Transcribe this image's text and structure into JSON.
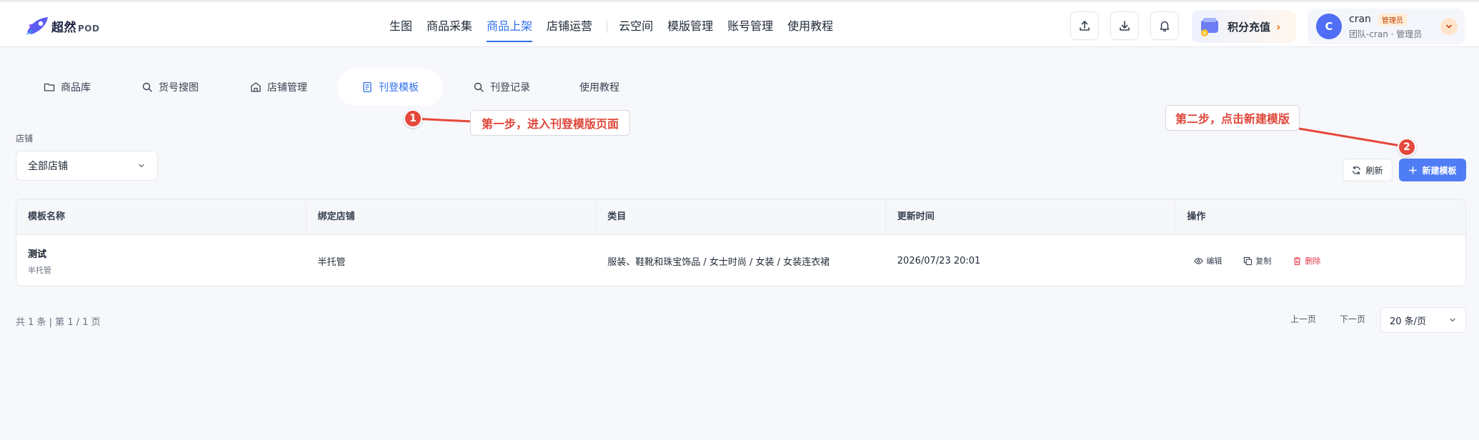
{
  "brand": {
    "logo_text": "超然",
    "logo_suffix": "POD",
    "accent_color": "#2f6fed"
  },
  "topnav": {
    "items": [
      "生图",
      "商品采集",
      "商品上架",
      "店铺运营",
      "云空间",
      "模版管理",
      "账号管理",
      "使用教程"
    ],
    "active": "商品上架"
  },
  "header_icons": [
    "upload-icon",
    "download-icon",
    "bell-icon"
  ],
  "recharge": {
    "label": "积分充值"
  },
  "user": {
    "avatar_letter": "C",
    "name": "cran",
    "role_badge": "管理员",
    "subtitle": "团队-cran · 管理员"
  },
  "tabs": {
    "items": [
      {
        "label": "商品库",
        "icon": "folder-icon"
      },
      {
        "label": "货号搜图",
        "icon": "search-icon"
      },
      {
        "label": "店铺管理",
        "icon": "store-icon"
      },
      {
        "label": "刊登模板",
        "icon": "template-icon"
      },
      {
        "label": "刊登记录",
        "icon": "search-icon"
      },
      {
        "label": "使用教程",
        "icon": ""
      }
    ],
    "active": "刊登模板"
  },
  "filters": {
    "shop_label": "店铺",
    "shop_value": "全部店铺"
  },
  "toolbar": {
    "refresh_label": "刷新",
    "new_label": "新建模板"
  },
  "table": {
    "columns": [
      "模板名称",
      "绑定店铺",
      "类目",
      "更新时间",
      "操作"
    ],
    "rows": [
      {
        "name": "测试",
        "name_sub": "半托管",
        "shop": "半托管",
        "category": "服装、鞋靴和珠宝饰品 / 女士时尚 / 女装 / 女装连衣裙",
        "updated": "2026/07/23 20:01",
        "actions": {
          "edit": "编辑",
          "copy": "复制",
          "delete": "删除"
        }
      }
    ]
  },
  "pagination": {
    "summary": "共 1 条 | 第 1 / 1 页",
    "prev": "上一页",
    "next": "下一页",
    "page_size": "20 条/页"
  },
  "annotations": [
    {
      "number": "1",
      "text": "第一步，进入刊登模版页面"
    },
    {
      "number": "2",
      "text": "第二步，点击新建模版"
    }
  ]
}
